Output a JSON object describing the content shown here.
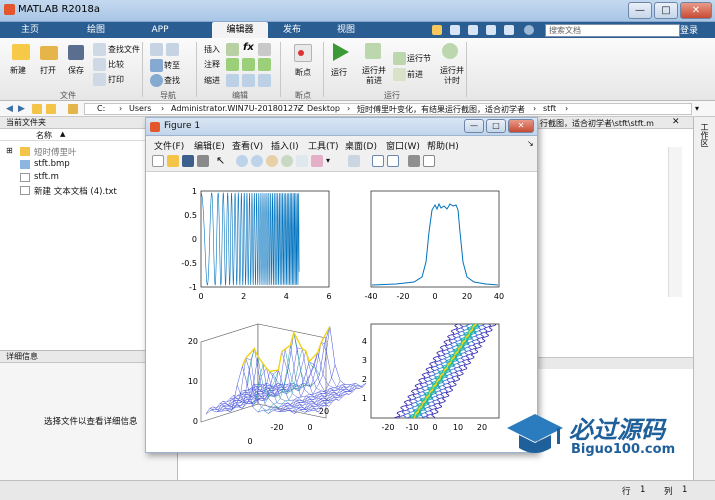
{
  "app": {
    "title": "MATLAB R2018a"
  },
  "window_controls": {
    "minimize": "—",
    "maximize": "□",
    "close": "✕"
  },
  "tabs": [
    "主页",
    "绘图",
    "APP",
    "编辑器",
    "发布",
    "视图"
  ],
  "search": {
    "placeholder": "搜索文档",
    "login": "登录"
  },
  "ribbon": {
    "file": {
      "new": "新建",
      "open": "打开",
      "save": "保存",
      "find_files": "查找文件",
      "compare": "比较",
      "print": "打印",
      "group": "文件"
    },
    "nav": {
      "goto": "转至",
      "find": "查找",
      "group": "导航"
    },
    "edit": {
      "insert": "插入",
      "comment": "注释",
      "indent": "缩进",
      "fx": "fx",
      "group": "编辑"
    },
    "breakpoints": {
      "label": "断点",
      "group": "断点"
    },
    "run": {
      "run": "运行",
      "run_advance": "运行并\n前进",
      "run_section": "运行节",
      "advance": "前进",
      "run_time": "运行并\n计时",
      "group": "运行"
    }
  },
  "address": {
    "segments": [
      "C:",
      "Users",
      "Administrator.WIN7U-20180127Z",
      "Desktop",
      "短时傅里叶变化，有结果运行截图，适合初学者",
      "stft"
    ]
  },
  "current_folder": {
    "header": "当前文件夹",
    "col_name": "名称",
    "items": [
      "短时傅里叶",
      "stft.bmp",
      "stft.m",
      "新建 文本文档 (4).txt"
    ]
  },
  "details": {
    "header": "详细信息",
    "message": "选择文件以查看详细信息"
  },
  "editor_behind": {
    "path_text": "行截图，适合初学者\\stft\\stft.m"
  },
  "right_panel": {
    "label": "工作区"
  },
  "status": {
    "row_label": "行",
    "row_value": "1",
    "col_label": "列",
    "col_value": "1"
  },
  "figure": {
    "title": "Figure 1",
    "menu": [
      "文件(F)",
      "编辑(E)",
      "查看(V)",
      "插入(I)",
      "工具(T)",
      "桌面(D)",
      "窗口(W)",
      "帮助(H)"
    ],
    "plot1": {
      "xticks": [
        "0",
        "2",
        "4",
        "6"
      ],
      "yticks": [
        "1",
        "0.5",
        "0",
        "-0.5",
        "-1"
      ]
    },
    "plot2": {
      "xticks": [
        "-40",
        "-20",
        "0",
        "20",
        "40"
      ]
    },
    "plot3": {
      "yticks": [
        "20",
        "10",
        "0"
      ],
      "xticks": [
        "0",
        "-20",
        "20",
        "0"
      ]
    },
    "plot4": {
      "xticks": [
        "-20",
        "-10",
        "0",
        "10",
        "20"
      ],
      "yticks": [
        "4",
        "3",
        "2",
        "1"
      ]
    }
  },
  "watermark": {
    "title": "必过源码",
    "url": "Biguo100.com"
  },
  "colors": {
    "tabbar": "#2a5d91",
    "plot_line": "#0072bd",
    "accent_yellow": "#f1c40f"
  }
}
